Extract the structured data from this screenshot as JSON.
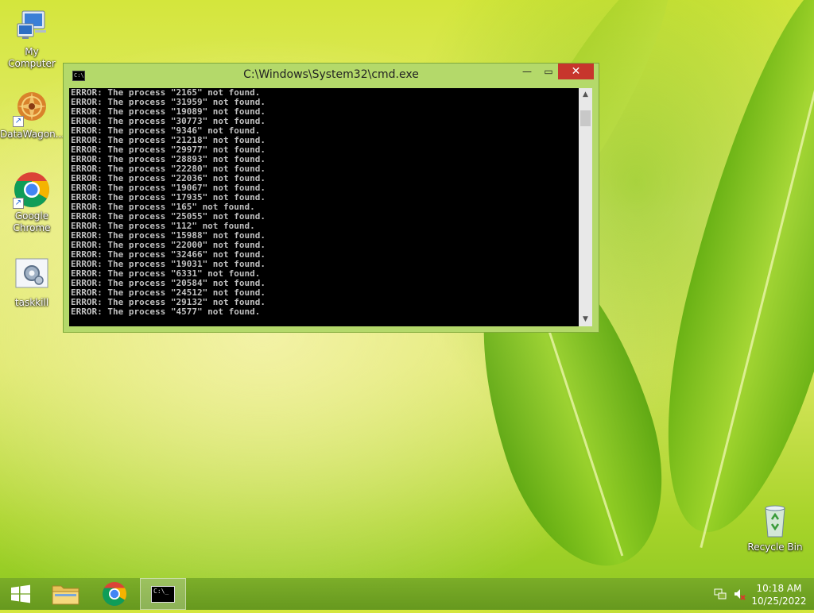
{
  "desktop": {
    "icons": [
      {
        "label": "My Computer"
      },
      {
        "label": "DataWagon..."
      },
      {
        "label": "Google Chrome"
      },
      {
        "label": "taskkill"
      },
      {
        "label": "Recycle Bin"
      }
    ]
  },
  "cmd_window": {
    "title": "C:\\Windows\\System32\\cmd.exe",
    "icon_text": "C:\\",
    "buttons": {
      "minimize": "—",
      "maximize": "▭",
      "close": "✕"
    },
    "scroll_up": "▲",
    "scroll_down": "▼",
    "lines": [
      "ERROR: The process \"2165\" not found.",
      "ERROR: The process \"31959\" not found.",
      "ERROR: The process \"19089\" not found.",
      "ERROR: The process \"30773\" not found.",
      "ERROR: The process \"9346\" not found.",
      "ERROR: The process \"21218\" not found.",
      "ERROR: The process \"29977\" not found.",
      "ERROR: The process \"28893\" not found.",
      "ERROR: The process \"22280\" not found.",
      "ERROR: The process \"22036\" not found.",
      "ERROR: The process \"19067\" not found.",
      "ERROR: The process \"17935\" not found.",
      "ERROR: The process \"165\" not found.",
      "ERROR: The process \"25055\" not found.",
      "ERROR: The process \"112\" not found.",
      "ERROR: The process \"15988\" not found.",
      "ERROR: The process \"22000\" not found.",
      "ERROR: The process \"32466\" not found.",
      "ERROR: The process \"19031\" not found.",
      "ERROR: The process \"6331\" not found.",
      "ERROR: The process \"20584\" not found.",
      "ERROR: The process \"24512\" not found.",
      "ERROR: The process \"29132\" not found.",
      "ERROR: The process \"4577\" not found."
    ]
  },
  "taskbar": {
    "items": [
      {
        "name": "start",
        "icon": "windows-logo"
      },
      {
        "name": "file-explorer",
        "icon": "folder"
      },
      {
        "name": "chrome",
        "icon": "chrome"
      },
      {
        "name": "cmd",
        "icon": "cmd",
        "active": true,
        "icon_text": "C:\\_"
      }
    ],
    "tray": {
      "network_icon": "network-icon",
      "volume_icon": "volume-muted-icon",
      "time": "10:18 AM",
      "date": "10/25/2022"
    }
  },
  "colors": {
    "console_bg": "#000000",
    "console_fg": "#c0c0c0",
    "window_frame": "#b4d96a",
    "close_button": "#c7362c"
  }
}
